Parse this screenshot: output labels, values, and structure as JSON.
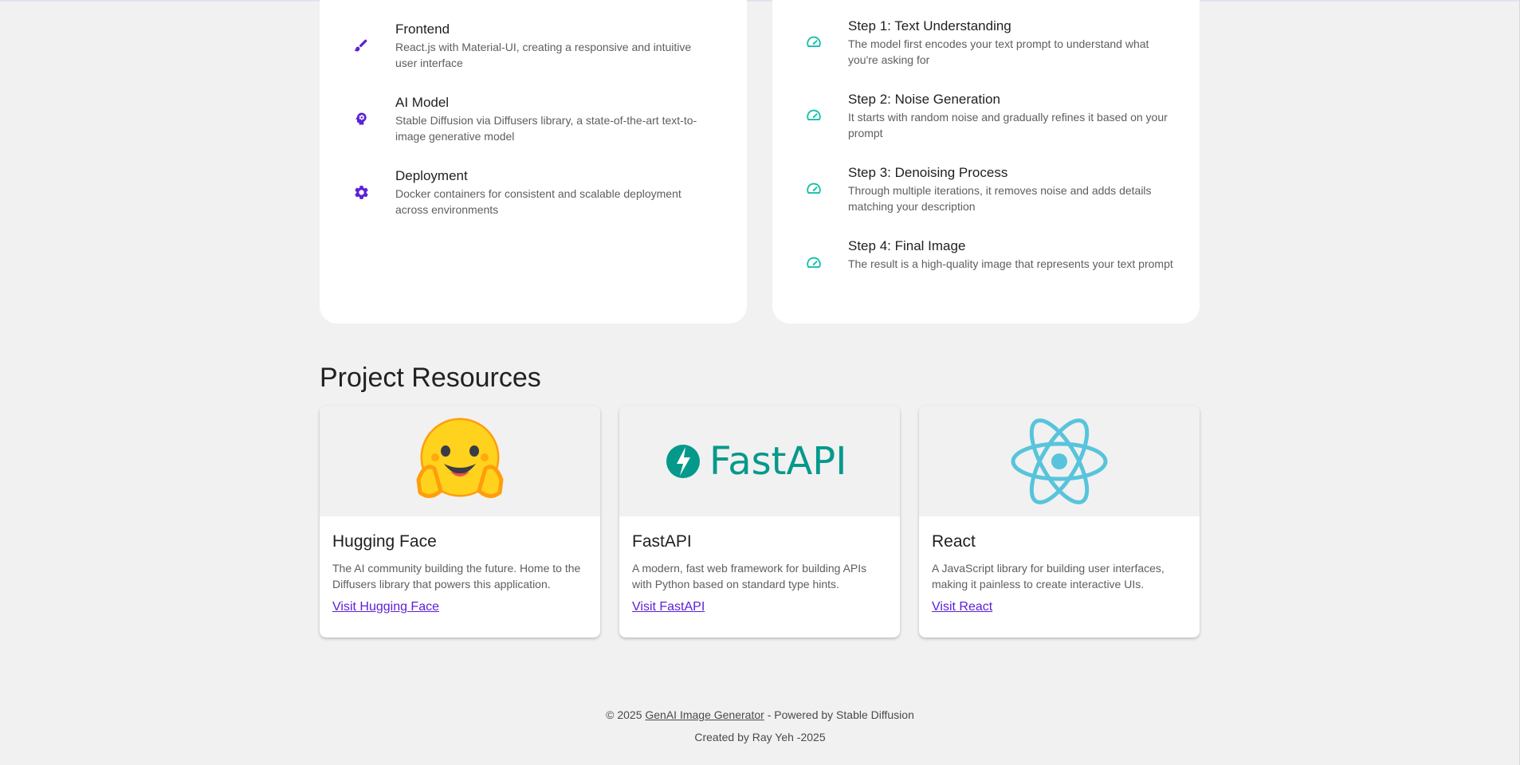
{
  "tech_stack": [
    {
      "title": "Frontend",
      "desc": "React.js with Material-UI, creating a responsive and intuitive user interface",
      "icon": "brush-icon"
    },
    {
      "title": "AI Model",
      "desc": "Stable Diffusion via Diffusers library, a state-of-the-art text-to-image generative model",
      "icon": "brain-icon"
    },
    {
      "title": "Deployment",
      "desc": "Docker containers for consistent and scalable deployment across environments",
      "icon": "gear-icon"
    }
  ],
  "steps": [
    {
      "title": "Step 1: Text Understanding",
      "desc": "The model first encodes your text prompt to understand what you're asking for",
      "icon": "speed-icon"
    },
    {
      "title": "Step 2: Noise Generation",
      "desc": "It starts with random noise and gradually refines it based on your prompt",
      "icon": "speed-icon"
    },
    {
      "title": "Step 3: Denoising Process",
      "desc": "Through multiple iterations, it removes noise and adds details matching your description",
      "icon": "speed-icon"
    },
    {
      "title": "Step 4: Final Image",
      "desc": "The result is a high-quality image that represents your text prompt",
      "icon": "speed-icon"
    }
  ],
  "resources": {
    "title": "Project Resources",
    "items": [
      {
        "title": "Hugging Face",
        "desc": "The AI community building the future. Home to the Diffusers library that powers this application.",
        "link": "Visit Hugging Face"
      },
      {
        "title": "FastAPI",
        "desc": "A modern, fast web framework for building APIs with Python based on standard type hints.",
        "link": "Visit FastAPI",
        "logo_text": "FastAPI"
      },
      {
        "title": "React",
        "desc": "A JavaScript library for building user interfaces, making it painless to create interactive UIs.",
        "link": "Visit React"
      }
    ]
  },
  "footer": {
    "copyright": "© 2025",
    "app_link": "GenAI Image Generator",
    "powered": "- Powered by Stable Diffusion",
    "credit": "Created by Ray Yeh -2025"
  },
  "colors": {
    "primary_purple": "#5b21d6",
    "teal": "#14c0a8",
    "fastapi_green": "#05998b",
    "react_cyan": "#58c4dc"
  }
}
